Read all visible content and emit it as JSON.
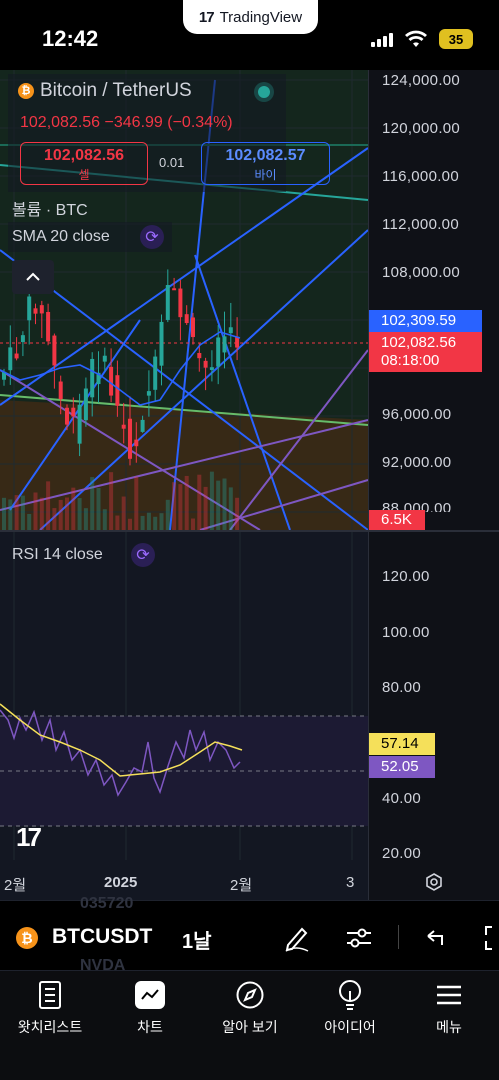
{
  "status_bar": {
    "time": "12:42",
    "app_pill": "TradingView",
    "battery": "35"
  },
  "legend": {
    "symbol_title": "Bitcoin / TetherUS",
    "last_price_line": "102,082.56  −346.99 (−0.34%)",
    "sell": {
      "price": "102,082.56",
      "label": "셀"
    },
    "spread": "0.01",
    "buy": {
      "price": "102,082.57",
      "label": "바이"
    },
    "volume_label": "볼륨 · BTC",
    "sma_label": "SMA 20 close",
    "rsi_label": "RSI 14 close"
  },
  "price_axis": {
    "labels": [
      "124,000.00",
      "120,000.00",
      "116,000.00",
      "112,000.00",
      "108,000.00",
      "96,000.00",
      "92,000.00",
      "88,000.00"
    ],
    "tag_blue": "102,309.59",
    "tag_red": "102,082.56",
    "tag_red_countdown": "08:18:00",
    "tag_volume": "6.5K"
  },
  "rsi_axis": {
    "labels": [
      "120.00",
      "100.00",
      "80.00",
      "40.00",
      "20.00"
    ],
    "tag_yellow": "57.14",
    "tag_purple": "52.05"
  },
  "x_axis": {
    "labels": [
      "2월",
      "2025",
      "2월",
      "3"
    ]
  },
  "symbol_bar": {
    "symbol": "BTCUSDT",
    "interval": "1날",
    "ghost_top": "035720",
    "ghost_bottom": "NVDA"
  },
  "nav": [
    {
      "label": "왓치리스트",
      "icon": "watchlist-icon"
    },
    {
      "label": "차트",
      "icon": "chart-icon"
    },
    {
      "label": "알아 보기",
      "icon": "compass-icon"
    },
    {
      "label": "아이디어",
      "icon": "bulb-icon"
    },
    {
      "label": "메뉴",
      "icon": "menu-icon"
    }
  ],
  "colors": {
    "up": "#26a69a",
    "down": "#f23645",
    "accent_blue": "#2962ff",
    "sma": "#2962ff",
    "rsi": "#7e57c2",
    "rsi_ma": "#f5e05a"
  }
}
